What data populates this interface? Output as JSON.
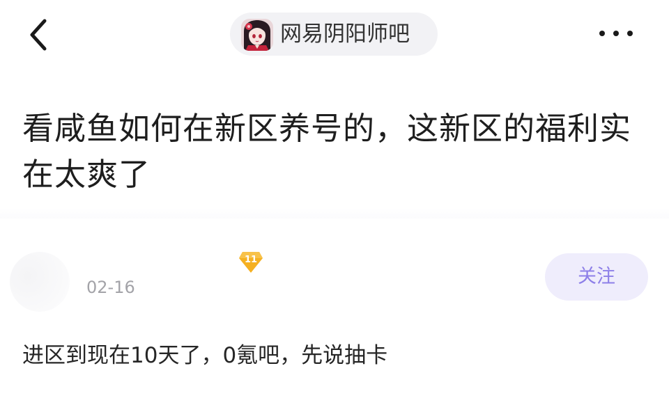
{
  "header": {
    "back_icon": "chevron-left-icon",
    "forum_name": "网易阴阳师吧",
    "forum_avatar_icon": "anime-character-avatar",
    "more_icon": "more-horizontal-icon"
  },
  "post": {
    "title": "看咸鱼如何在新区养号的，这新区的福利实在太爽了",
    "author": {
      "level": "11",
      "date": "02-16",
      "follow_label": "关注"
    },
    "body": "进区到现在10天了，0氪吧，先说抽卡"
  },
  "colors": {
    "accent": "#8d7fe8",
    "follow_bg": "#efedfc",
    "badge": "#f5b021",
    "pill_bg": "#f2f2f5"
  }
}
